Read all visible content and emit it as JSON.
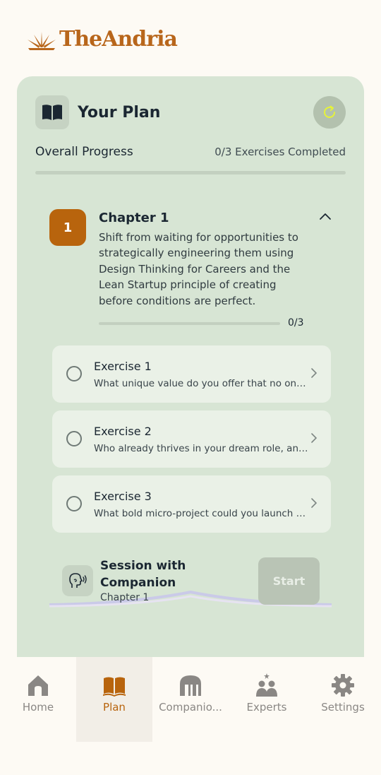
{
  "brand": {
    "name": "TheAndria",
    "color": "#b8661b"
  },
  "plan": {
    "title": "Your Plan",
    "progress_label": "Overall Progress",
    "progress_status": "0/3 Exercises Completed",
    "progress_fraction": 0
  },
  "chapter": {
    "number": "1",
    "title": "Chapter 1",
    "description": "Shift from waiting for opportunities to strategically engineering them using Design Thinking for Careers and the Lean Startup principle of creating before conditions are perfect.",
    "count": "0/3",
    "progress_fraction": 0,
    "expanded": true
  },
  "exercises": [
    {
      "title": "Exercise 1",
      "subtitle": "What unique value do you offer that no one else can?",
      "completed": false
    },
    {
      "title": "Exercise 2",
      "subtitle": "Who already thrives in your dream role, and what can you learn?",
      "completed": false
    },
    {
      "title": "Exercise 3",
      "subtitle": "What bold micro-project could you launch this week?",
      "completed": false
    }
  ],
  "session": {
    "title": "Session with Companion",
    "subtitle": "Chapter 1",
    "start_label": "Start"
  },
  "nav": [
    {
      "label": "Home",
      "icon": "home-icon",
      "active": false
    },
    {
      "label": "Plan",
      "icon": "book-icon",
      "active": true
    },
    {
      "label": "Companio...",
      "icon": "companion-icon",
      "active": false
    },
    {
      "label": "Experts",
      "icon": "experts-icon",
      "active": false
    },
    {
      "label": "Settings",
      "icon": "gear-icon",
      "active": false
    }
  ],
  "colors": {
    "card_bg": "#d7e5d4",
    "accent": "#b8640d",
    "exercise_bg": "#eaf1e7",
    "nav_inactive": "#8a8784"
  }
}
